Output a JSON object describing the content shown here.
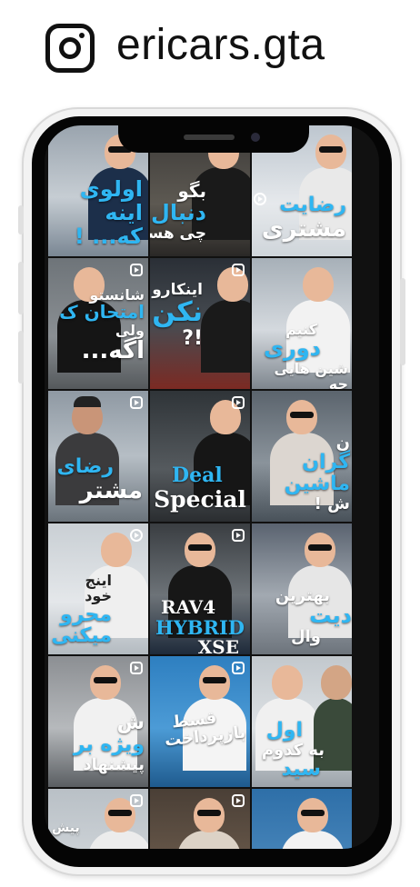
{
  "header": {
    "handle": "ericars.gta",
    "icon": "instagram-icon"
  },
  "colors": {
    "accent_blue": "#2fb6f2",
    "text_white": "#ffffff",
    "phone_frame": "#050505"
  },
  "grid": {
    "tiles": [
      {
        "lines": [
          "اولوی",
          "اینه",
          "که... !"
        ],
        "reel": false
      },
      {
        "lines": [
          "بگو",
          "دنبال",
          "چی هستی ؟!"
        ],
        "reel": false
      },
      {
        "lines": [
          "رضایت",
          "مشتری"
        ],
        "reel": false
      },
      {
        "lines": [
          "شانستو",
          "امتحان ک",
          "ولی",
          "اگه..."
        ],
        "reel": true
      },
      {
        "lines": [
          "اینکارو",
          "نکن",
          "!?"
        ],
        "reel": true
      },
      {
        "lines": [
          "کنیم",
          "دوری",
          "شین هایی",
          "چه"
        ],
        "reel": false
      },
      {
        "lines": [
          "رضای",
          "مشتر"
        ],
        "reel": true
      },
      {
        "lines": [
          "Deal",
          "Special"
        ],
        "reel": true
      },
      {
        "lines": [
          "ن",
          "گران",
          "ماشین",
          "ش !"
        ],
        "reel": false
      },
      {
        "lines": [
          "اینج",
          "خود",
          "محرو",
          "میکنی"
        ],
        "reel": false
      },
      {
        "lines": [
          "RAV4",
          "HYBRID",
          "XSE"
        ],
        "reel": true
      },
      {
        "lines": [
          "بهترین",
          "دیت",
          "وال"
        ],
        "reel": false
      },
      {
        "lines": [
          "ش",
          "ویژه بر",
          "پیشنهاد"
        ],
        "reel": true
      },
      {
        "lines": [
          "قسط",
          "بازپرداخت"
        ],
        "reel": true
      },
      {
        "lines": [
          "اول",
          "به کدوم",
          "سید"
        ],
        "reel": false
      },
      {
        "lines": [
          "پیش"
        ],
        "reel": true
      },
      {
        "lines": [],
        "reel": true
      },
      {
        "lines": [],
        "reel": false
      }
    ]
  }
}
